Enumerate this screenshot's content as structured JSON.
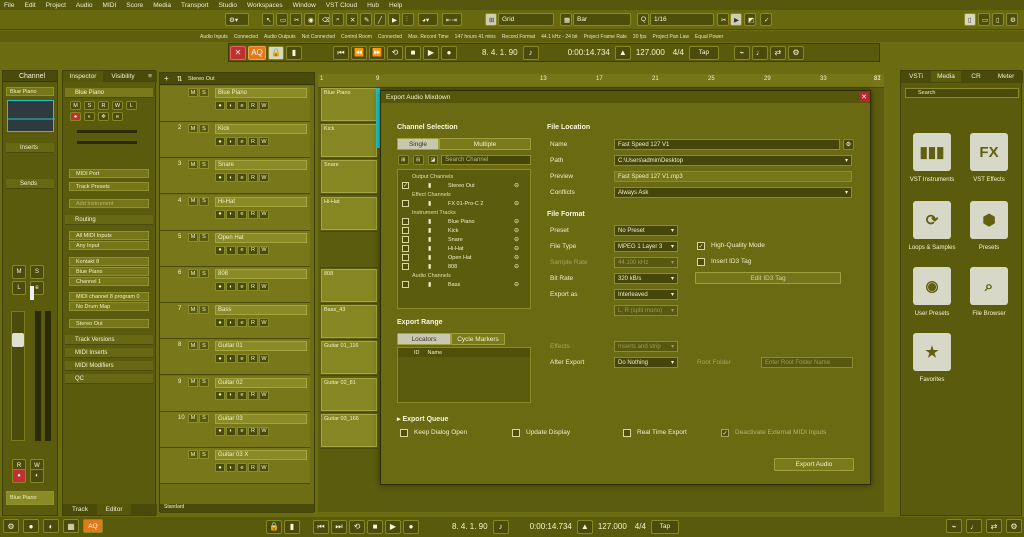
{
  "menu": [
    "File",
    "Edit",
    "Project",
    "Audio",
    "MIDI",
    "Score",
    "Media",
    "Transport",
    "Studio",
    "Workspaces",
    "Window",
    "VST Cloud",
    "Hub",
    "Help"
  ],
  "toolbar": {
    "snap_type": "Grid",
    "grid_type": "Bar",
    "quantize": "1/16"
  },
  "status": [
    "Audio Inputs",
    "Connected",
    "Audio Outputs",
    "Not Connected",
    "Control Room",
    "Connected",
    "Max. Record Time",
    "147 hours 41 mins",
    "Record Format",
    "44.1 kHz - 24 bit",
    "Project Frame Rate",
    "30 fps",
    "Project Pan Law",
    "Equal Power"
  ],
  "transport_top": {
    "aq": "AQ",
    "position": "8. 4. 1. 90",
    "time": "0:00:14.734",
    "tempo": "127.000",
    "signature": "4/4",
    "tap": "Tap"
  },
  "transport_bottom": {
    "aq": "AQ",
    "position": "8. 4. 1. 90",
    "time": "0:00:14.734",
    "tempo": "127.000",
    "signature": "4/4",
    "tap": "Tap"
  },
  "left": {
    "tabs": [
      "Channel",
      "Inspector",
      "Visibility"
    ],
    "channel_name": "Blue Piano",
    "sections": [
      "Inserts",
      "Sends"
    ],
    "bottom_name": "Blue Piano",
    "bottom_tabs": [
      "Track",
      "Editor"
    ]
  },
  "inspector": {
    "track": "Blue Piano",
    "midi_port": "MIDI Port",
    "track_preset": "Track Presets",
    "add_instrument": "Add Instrument",
    "routing": "Routing",
    "input": "All MIDI Inputs",
    "input2": "Any Input",
    "instrument": "Kontakt 8",
    "out": "Blue Piano",
    "channel": "Channel 1",
    "program": "MIDI channel 8 program 0",
    "drum_map": "No Drum Map",
    "stereo": "Stereo Out",
    "sections": [
      "Track Versions",
      "MIDI Inserts",
      "MIDI Modifiers",
      "QC"
    ]
  },
  "tracks": [
    {
      "num": "",
      "name": "Blue Piano"
    },
    {
      "num": "2",
      "name": "Kick"
    },
    {
      "num": "3",
      "name": "Snare"
    },
    {
      "num": "4",
      "name": "Hi-Hat"
    },
    {
      "num": "5",
      "name": "Open Hat"
    },
    {
      "num": "6",
      "name": "808"
    },
    {
      "num": "7",
      "name": "Bass"
    },
    {
      "num": "8",
      "name": "Guitar 01"
    },
    {
      "num": "9",
      "name": "Guitar 02"
    },
    {
      "num": "10",
      "name": "Guitar 03"
    },
    {
      "num": "",
      "name": "Guitar 03 X"
    }
  ],
  "track_header_label": "Stereo Out",
  "clips": [
    {
      "name": "Blue Piano"
    },
    {
      "name": "Kick"
    },
    {
      "name": "Snare"
    },
    {
      "name": "Hi-Hat"
    },
    {
      "name": ""
    },
    {
      "name": "808"
    },
    {
      "name": "Bass_43"
    },
    {
      "name": "Guitar 01_116"
    },
    {
      "name": "Guitar 02_81"
    },
    {
      "name": "Guitar 03_166"
    }
  ],
  "ruler": [
    "1",
    "9",
    "13",
    "17",
    "21",
    "25",
    "29",
    "33",
    "37",
    "81"
  ],
  "dialog": {
    "title": "Export Audio Mixdown",
    "channel_selection": "Channel Selection",
    "single": "Single",
    "multiple": "Multiple",
    "search": "Search Channel",
    "groups": [
      {
        "label": "Output Channels",
        "items": [
          "Stereo Out"
        ]
      },
      {
        "label": "Effect Channels",
        "items": [
          "FX 01-Pro-C 2"
        ]
      },
      {
        "label": "Instrument Tracks",
        "items": [
          "Blue Piano",
          "Kick",
          "Snare",
          "Hi-Hat",
          "Open Hat",
          "808"
        ]
      },
      {
        "label": "Audio Channels",
        "items": [
          "Bass"
        ]
      }
    ],
    "export_range": "Export Range",
    "locators": "Locators",
    "cycle_markers": "Cycle Markers",
    "col_id": "ID",
    "col_name": "Name",
    "file_location": "File Location",
    "name_label": "Name",
    "name_value": "Fast Speed 127 V1",
    "path_label": "Path",
    "path_value": "C:\\Users\\admin\\Desktop",
    "preview_label": "Preview",
    "preview_value": "Fast Speed 127 V1.mp3",
    "conflicts_label": "Conflicts",
    "conflicts_value": "Always Ask",
    "file_format": "File Format",
    "preset_label": "Preset",
    "preset_value": "No Preset",
    "filetype_label": "File Type",
    "filetype_value": "MPEG 1 Layer 3",
    "samplerate_label": "Sample Rate",
    "samplerate_value": "44.100 kHz",
    "bitrate_label": "Bit Rate",
    "bitrate_value": "320 kB/s",
    "exportas_label": "Export as",
    "exportas_value": "Interleaved",
    "splitmono": "L, R (split mono)",
    "hq_mode": "High-Quality Mode",
    "insert_id3": "Insert ID3 Tag",
    "edit_id3": "Edit ID3 Tag",
    "effects_label": "Effects",
    "effects_value": "Inserts and strip",
    "after_export_label": "After Export",
    "after_export_value": "Do Nothing",
    "root_folder": "Root Folder",
    "root_placeholder": "Enter Root Folder Name",
    "export_queue": "Export Queue",
    "keep_open": "Keep Dialog Open",
    "update_display": "Update Display",
    "real_time": "Real Time Export",
    "deactivate_midi": "Deactivate External MIDI Inputs",
    "export_button": "Export Audio"
  },
  "right": {
    "tabs": [
      "VSTi",
      "Media",
      "CR",
      "Meter"
    ],
    "search": "Search",
    "items": [
      {
        "icon": "piano",
        "label": "VST Instruments"
      },
      {
        "icon": "FX",
        "label": "VST Effects"
      },
      {
        "icon": "loop",
        "label": "Loops & Samples"
      },
      {
        "icon": "hex",
        "label": "Presets"
      },
      {
        "icon": "user",
        "label": "User Presets"
      },
      {
        "icon": "browse",
        "label": "File Browser"
      },
      {
        "icon": "star",
        "label": "Favorites"
      }
    ]
  },
  "colors": {
    "bg": "#6b6b12",
    "accent_red": "#c03030",
    "accent_orange": "#e07a1a",
    "cyan": "#1ec8c8"
  }
}
